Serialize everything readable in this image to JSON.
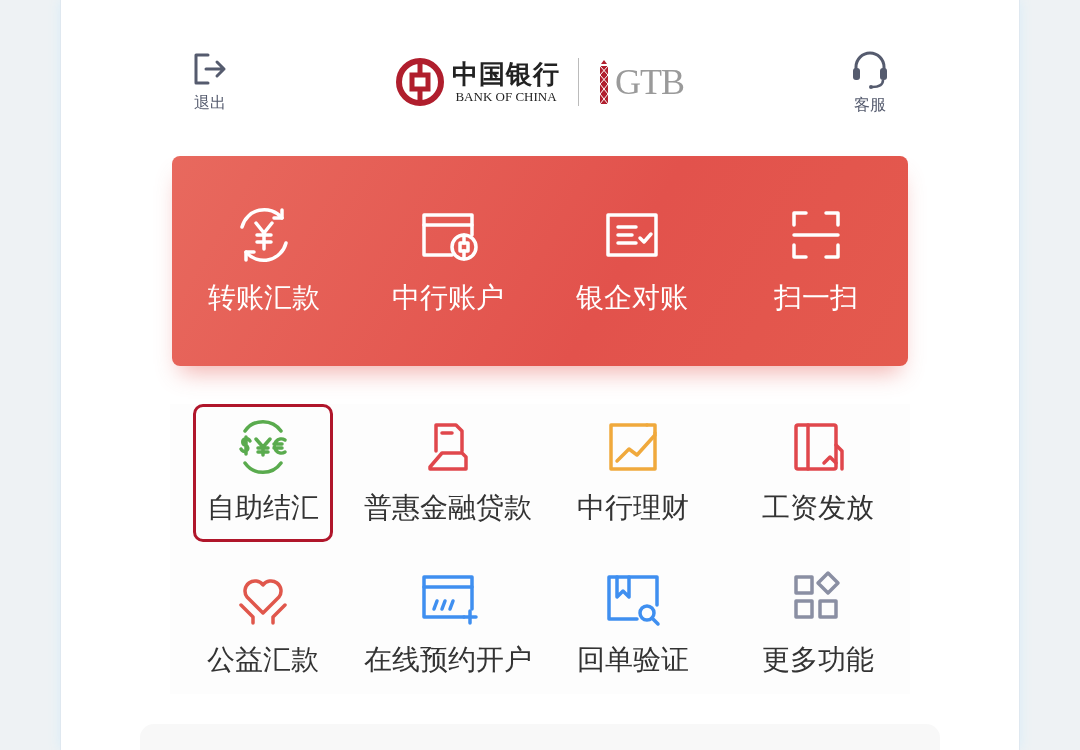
{
  "header": {
    "logout_label": "退出",
    "logo": {
      "name_zh": "中国银行",
      "name_en": "BANK OF CHINA",
      "partner": "GTB"
    },
    "service_label": "客服"
  },
  "banner": [
    {
      "label": "转账汇款"
    },
    {
      "label": "中行账户"
    },
    {
      "label": "银企对账"
    },
    {
      "label": "扫一扫"
    }
  ],
  "services": [
    {
      "label": "自助结汇",
      "selected": true
    },
    {
      "label": "普惠金融贷款",
      "selected": false
    },
    {
      "label": "中行理财",
      "selected": false
    },
    {
      "label": "工资发放",
      "selected": false
    },
    {
      "label": "公益汇款",
      "selected": false
    },
    {
      "label": "在线预约开户",
      "selected": false
    },
    {
      "label": "回单验证",
      "selected": false
    },
    {
      "label": "更多功能",
      "selected": false
    }
  ]
}
